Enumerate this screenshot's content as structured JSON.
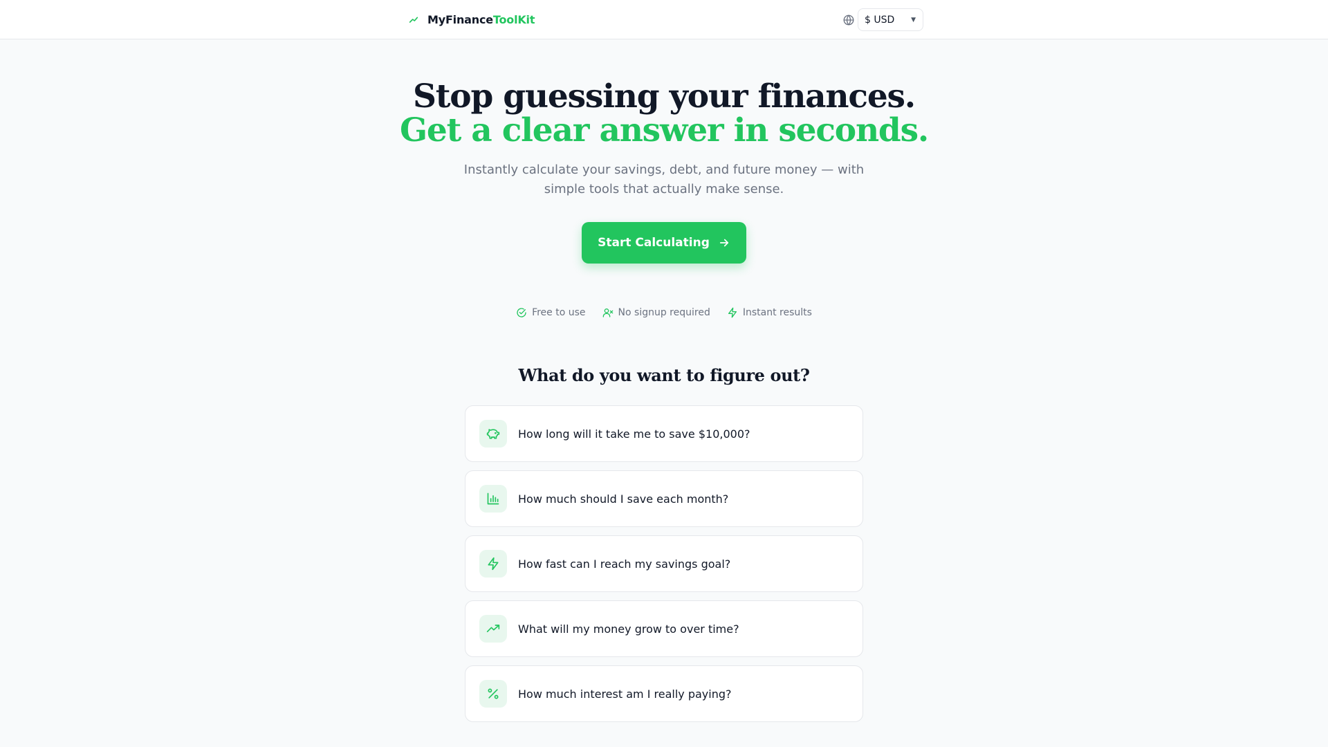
{
  "header": {
    "brand_main": "MyFinance",
    "brand_accent": "ToolKit",
    "currency": {
      "value": "$ USD",
      "icon": "globe-icon"
    }
  },
  "hero": {
    "title_line1": "Stop guessing your finances.",
    "title_line2": "Get a clear answer in seconds.",
    "subtitle": "Instantly calculate your savings, debt, and future money — with simple tools that actually make sense.",
    "cta_label": "Start Calculating"
  },
  "features": [
    {
      "label": "Free to use",
      "icon": "check-circle-icon"
    },
    {
      "label": "No signup required",
      "icon": "user-x-icon"
    },
    {
      "label": "Instant results",
      "icon": "zap-icon"
    }
  ],
  "section": {
    "title": "What do you want to figure out?",
    "questions": [
      {
        "label": "How long will it take me to save $10,000?",
        "icon": "piggy-bank-icon"
      },
      {
        "label": "How much should I save each month?",
        "icon": "bar-chart-icon"
      },
      {
        "label": "How fast can I reach my savings goal?",
        "icon": "zap-icon"
      },
      {
        "label": "What will my money grow to over time?",
        "icon": "trending-up-icon"
      },
      {
        "label": "How much interest am I really paying?",
        "icon": "percent-icon"
      }
    ]
  },
  "colors": {
    "accent": "#22c55e",
    "accent_soft": "#e8f7ee",
    "text": "#111827",
    "muted": "#6b7280",
    "background": "#f8fafb"
  }
}
